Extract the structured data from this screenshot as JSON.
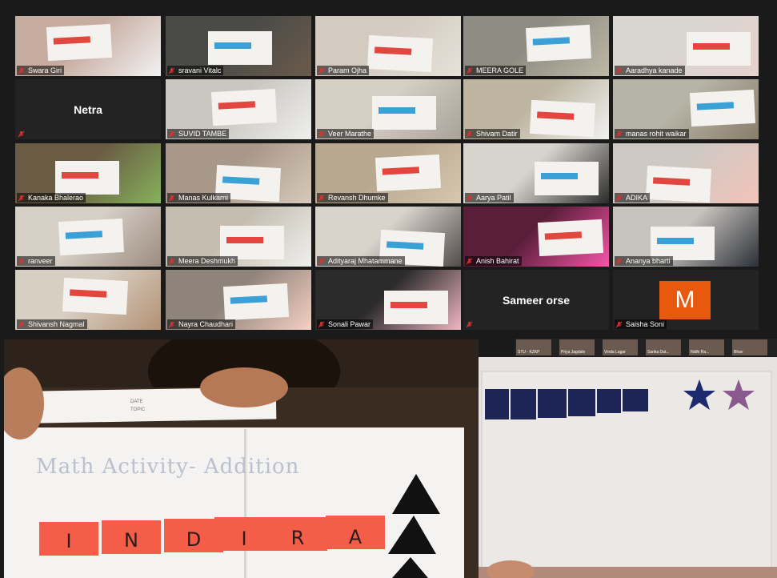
{
  "participants": [
    {
      "name": "Swara Giri"
    },
    {
      "name": "sravani Vitalc"
    },
    {
      "name": "Param Ojha"
    },
    {
      "name": "MEERA GOLE"
    },
    {
      "name": "Aaradhya kanade"
    },
    {
      "name": "Netra",
      "camera_off": true
    },
    {
      "name": "SUVID TAMBE"
    },
    {
      "name": "Veer Marathe"
    },
    {
      "name": "Shivam Datir"
    },
    {
      "name": "manas rohit waikar"
    },
    {
      "name": "Kanaka Bhalerao"
    },
    {
      "name": "Manas Kulkarni"
    },
    {
      "name": "Revansh Dhumke"
    },
    {
      "name": "Aarya Patil"
    },
    {
      "name": "ADIKA"
    },
    {
      "name": "ranveer"
    },
    {
      "name": "Meera Deshmukh"
    },
    {
      "name": "Adityaraj Mhatammane"
    },
    {
      "name": "Anish Bahirat"
    },
    {
      "name": "Ananya bharti"
    },
    {
      "name": "Shivansh Nagmal"
    },
    {
      "name": "Nayra Chaudhari"
    },
    {
      "name": "Sonali Pawar"
    },
    {
      "name": "Sameer orse",
      "camera_off": true
    },
    {
      "name": "Saisha Soni",
      "avatar_letter": "M"
    }
  ],
  "shared_left": {
    "page_header_date": "DATE",
    "page_header_topic": "TOPIC",
    "title": "Math Activity- Addition",
    "letters": [
      "I",
      "N",
      "D",
      "I",
      "R",
      "A"
    ]
  },
  "strip_labels": [
    "STU - KZKP",
    "Priya Jagdale",
    "Vinda Lagar",
    "Sarika Dat...",
    "Nidhi Ra...",
    "Bhav"
  ],
  "colors": {
    "muted_mic": "#e0322d",
    "avatar": "#e8580f"
  }
}
